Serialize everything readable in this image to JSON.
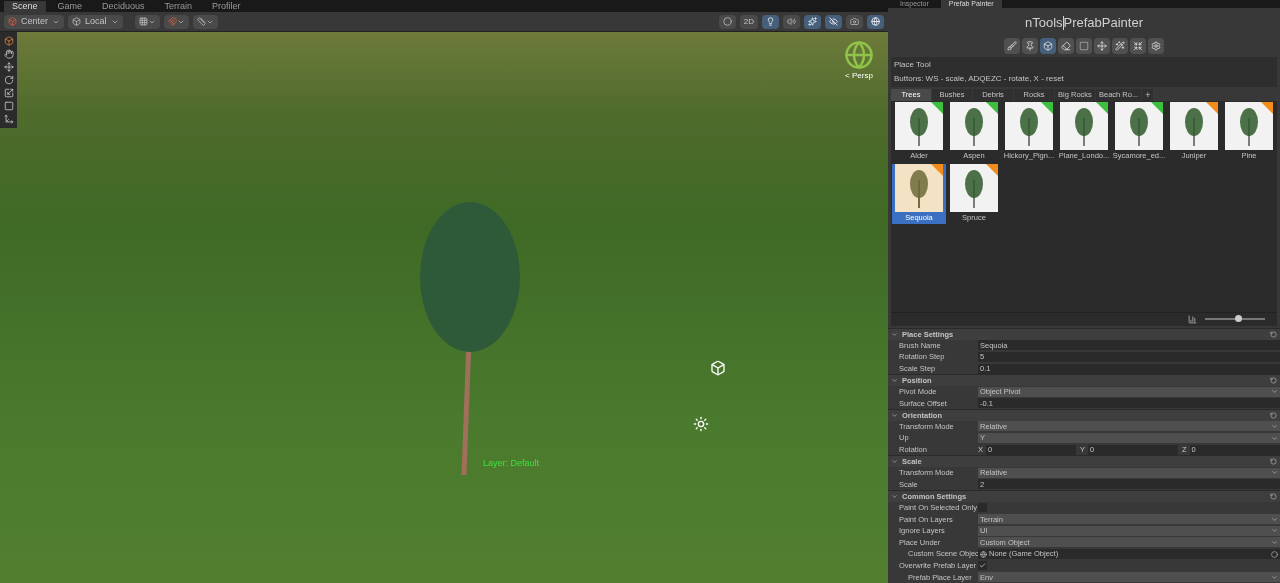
{
  "editor_tabs": [
    {
      "label": "Scene",
      "selected": true
    },
    {
      "label": "Game",
      "selected": false
    },
    {
      "label": "Deciduous",
      "selected": false
    },
    {
      "label": "Terrain",
      "selected": false
    },
    {
      "label": "Profiler",
      "selected": false
    }
  ],
  "scene_toolbar": {
    "pivot": "Center",
    "space": "Local",
    "right": [
      {
        "kind": "shading",
        "on": false
      },
      {
        "kind": "dimension",
        "label": "2D",
        "on": false
      },
      {
        "kind": "light",
        "on": true
      },
      {
        "kind": "audio",
        "on": false
      },
      {
        "kind": "effects",
        "on": true
      },
      {
        "kind": "hidden",
        "on": true
      },
      {
        "kind": "camera",
        "on": false
      },
      {
        "kind": "gizmos",
        "on": true
      }
    ]
  },
  "scene": {
    "gizmo_label": "< Persp",
    "layer_label": "Layer: Default"
  },
  "panel_tabs": [
    {
      "label": "Inspector",
      "selected": false
    },
    {
      "label": "Prefab Painter",
      "selected": true
    }
  ],
  "painter": {
    "title_left": "nTools",
    "title_right": "PrefabPainter",
    "tools": [
      {
        "kind": "brush",
        "selected": false
      },
      {
        "kind": "pin",
        "selected": false
      },
      {
        "kind": "place",
        "selected": true
      },
      {
        "kind": "eraser",
        "selected": false
      },
      {
        "kind": "select",
        "selected": false
      },
      {
        "kind": "move",
        "selected": false
      },
      {
        "kind": "wand",
        "selected": false
      },
      {
        "kind": "scatter",
        "selected": false
      },
      {
        "kind": "settings",
        "selected": false
      }
    ],
    "tool_name": "Place Tool",
    "tool_hint": "Buttons: WS - scale, ADQEZC - rotate, X - reset",
    "categories": [
      {
        "label": "Trees",
        "selected": true
      },
      {
        "label": "Bushes",
        "selected": false
      },
      {
        "label": "Debris",
        "selected": false
      },
      {
        "label": "Rocks",
        "selected": false
      },
      {
        "label": "Big Rocks",
        "selected": false
      },
      {
        "label": "Beach Ro...",
        "selected": false
      }
    ],
    "add_label": "+",
    "prefabs": [
      {
        "name": "Alder",
        "color": "#3fbf3f",
        "selected": false
      },
      {
        "name": "Aspen",
        "color": "#3fbf3f",
        "selected": false
      },
      {
        "name": "Hickory_Pign...",
        "color": "#3fbf3f",
        "selected": false
      },
      {
        "name": "Plane_Londo...",
        "color": "#3fbf3f",
        "selected": false
      },
      {
        "name": "Sycamore_ed...",
        "color": "#3fbf3f",
        "selected": false
      },
      {
        "name": "Juniper",
        "color": "#f28c1c",
        "selected": false
      },
      {
        "name": "Pine",
        "color": "#f28c1c",
        "selected": false
      },
      {
        "name": "Sequoia",
        "color": "#f28c1c",
        "selected": true
      },
      {
        "name": "Spruce",
        "color": "#f28c1c",
        "selected": false
      }
    ],
    "thumb_size": {
      "level": 0.55
    }
  },
  "sections": [
    {
      "title": "Place Settings",
      "fields": [
        {
          "kind": "text",
          "label": "Brush Name",
          "value": "Sequoia"
        },
        {
          "kind": "text",
          "label": "Rotation Step",
          "value": "5"
        },
        {
          "kind": "text",
          "label": "Scale Step",
          "value": "0.1"
        }
      ]
    },
    {
      "title": "Position",
      "fields": [
        {
          "kind": "dropdown",
          "label": "Pivot Mode",
          "value": "Object Pivot"
        },
        {
          "kind": "text",
          "label": "Surface Offset",
          "value": "-0.1"
        }
      ]
    },
    {
      "title": "Orientation",
      "fields": [
        {
          "kind": "dropdown",
          "label": "Transform Mode",
          "value": "Relative"
        },
        {
          "kind": "dropdown",
          "label": "Up",
          "value": "Y"
        },
        {
          "kind": "xyz",
          "label": "Rotation",
          "parts": [
            {
              "axis": "X",
              "value": "0"
            },
            {
              "axis": "Y",
              "value": "0"
            },
            {
              "axis": "Z",
              "value": "0"
            }
          ]
        }
      ]
    },
    {
      "title": "Scale",
      "fields": [
        {
          "kind": "dropdown",
          "label": "Transform Mode",
          "value": "Relative"
        },
        {
          "kind": "text",
          "label": "Scale",
          "value": "2"
        }
      ]
    },
    {
      "title": "Common Settings",
      "fields": [
        {
          "kind": "checkbox",
          "label": "Paint On Selected Only",
          "checked": false
        },
        {
          "kind": "dropdown",
          "label": "Paint On Layers",
          "value": "Terrain"
        },
        {
          "kind": "dropdown",
          "label": "Ignore Layers",
          "value": "UI"
        },
        {
          "kind": "dropdown",
          "label": "Place Under",
          "value": "Custom Object"
        },
        {
          "kind": "object",
          "label": "Custom Scene Objec",
          "value": "None (Game Object)",
          "indent": true
        },
        {
          "kind": "checkbox",
          "label": "Overwrite Prefab Layer",
          "checked": true
        },
        {
          "kind": "dropdown",
          "label": "Prefab Place Layer",
          "value": "Env",
          "indent": true
        }
      ]
    }
  ]
}
